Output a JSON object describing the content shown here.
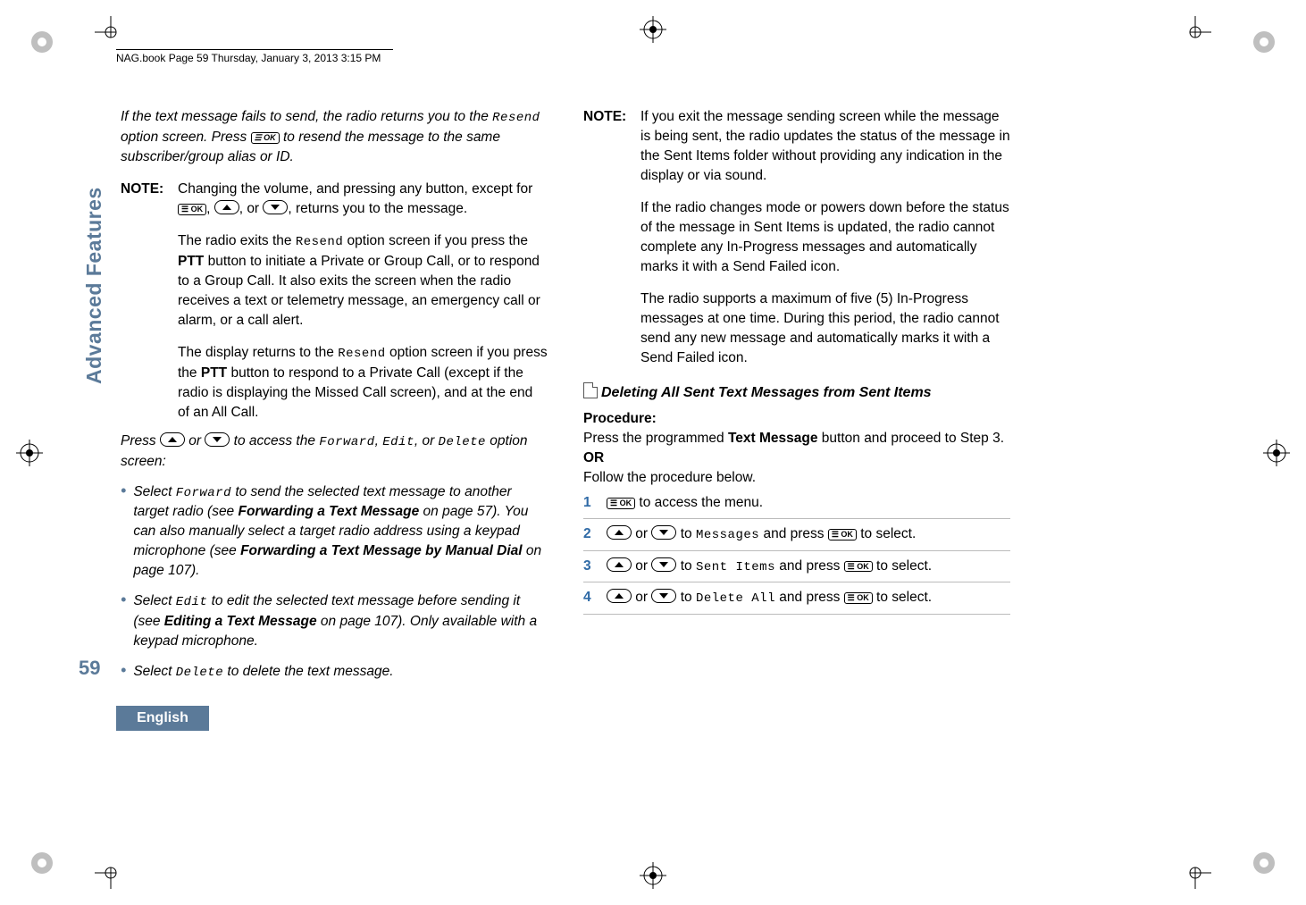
{
  "header": "NAG.book  Page 59  Thursday, January 3, 2013  3:15 PM",
  "left": {
    "intro1a": "If the text message fails to send, the radio returns you to the ",
    "intro1b": " option screen. Press ",
    "intro1c": " to resend the message to the same subscriber/group alias or ID.",
    "resend": "Resend",
    "note_label": "NOTE:",
    "note1a": "Changing the volume, and pressing any button, except for ",
    "note1b": ", returns you to the message.",
    "note2a": "The radio exits the ",
    "note2b": " option screen if you press the ",
    "ptt": "PTT",
    "note2c": " button to initiate a Private or Group Call, or to respond to a Group Call. It also exits the screen when the radio receives a text or telemetry message, an emergency call or alarm, or a call alert.",
    "note3a": "The display returns to the ",
    "note3b": " option screen if you press the ",
    "note3c": " button to respond to a Private Call (except if the radio is displaying the Missed Call screen), and at the end of an All Call.",
    "press_a": "Press ",
    "press_b": " or ",
    "press_c": " to access the ",
    "forward": "Forward",
    "edit": "Edit",
    "deleteWord": "Delete",
    "press_d": ", or ",
    "press_e": " option screen:",
    "b1a": "Select ",
    "b1b": " to send the selected text message to another target radio (see ",
    "b1c": "Forwarding a Text Message",
    "b1d": " on page 57). You can also manually select a target radio address using a keypad microphone (see ",
    "b1e": "Forwarding a Text Message by Manual Dial",
    "b1f": " on page 107).",
    "b2a": "Select ",
    "b2b": " to edit the selected text message before sending it (see ",
    "b2c": "Editing a Text Message",
    "b2d": " on page 107). Only available with a keypad microphone.",
    "b3a": "Select ",
    "b3b": " to delete the text message."
  },
  "right": {
    "note_label": "NOTE:",
    "n1": "If you exit the message sending screen while the message is being sent, the radio updates the status of the message in the Sent Items folder without providing any indication in the display or via sound.",
    "n2": "If the radio changes mode or powers down before the status of the message in Sent Items is updated, the radio cannot complete any In-Progress messages and automatically marks it with a Send Failed icon.",
    "n3": "The radio supports a maximum of five (5) In-Progress messages at one time. During this period, the radio cannot send any new message and automatically marks it with a Send Failed icon.",
    "section": "Deleting All Sent Text Messages from Sent Items",
    "procedure": "Procedure:",
    "p1a": "Press the programmed ",
    "p1b": "Text Message",
    "p1c": " button and proceed to Step 3.",
    "or": "OR",
    "follow": "Follow the procedure below.",
    "s1": " to access the menu.",
    "s2a": " or ",
    "s2b": " to ",
    "messages": "Messages",
    "s2c": " and press ",
    "s2d": " to select.",
    "sent_items": "Sent Items",
    "delete_all": "Delete All"
  },
  "sidebar": "Advanced Features",
  "pagenum": "59",
  "language": "English",
  "ok": "OK",
  "menuok": "☰ OK"
}
